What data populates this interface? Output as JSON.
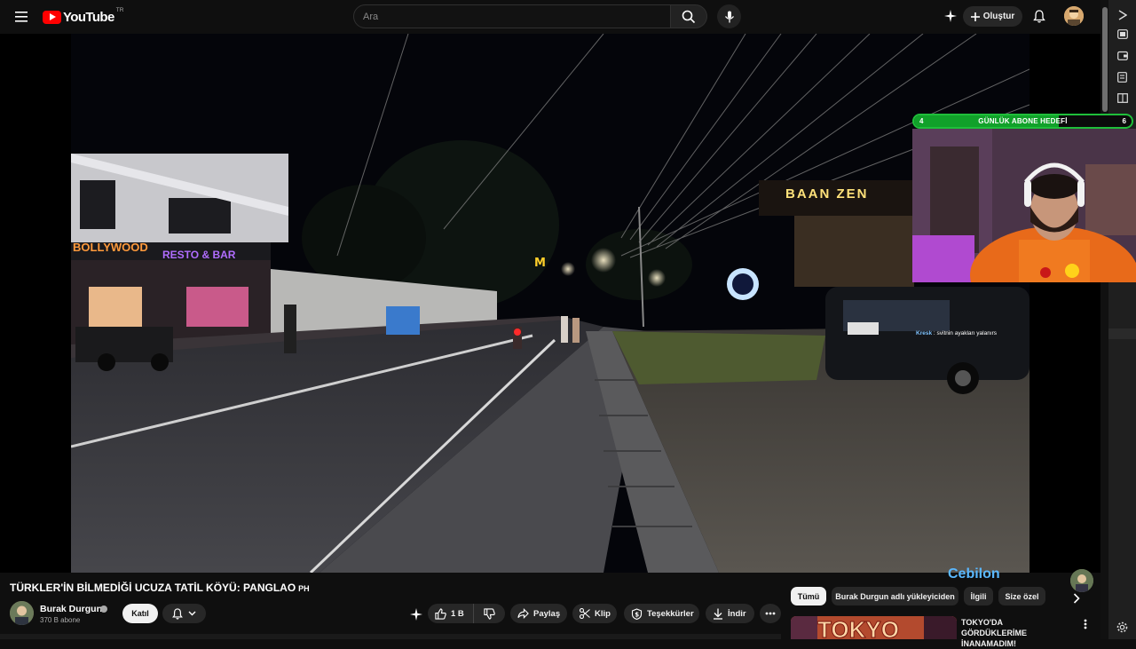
{
  "topbar": {
    "logo_text": "YouTube",
    "country_code": "TR",
    "search_placeholder": "Ara",
    "create_label": "Oluştur"
  },
  "video": {
    "overlay": {
      "goal_title": "GÜNLÜK ABONE HEDEFİ",
      "goal_current": "4",
      "goal_target": "6",
      "goal_progress": 0.667,
      "chat_user": "Kresk",
      "chat_message": ": svitnin ayakları yalanırs",
      "watermark": "Cebilon"
    },
    "signs": {
      "bollywood": "BOLLYWOOD",
      "resto_bar": "RESTO & BAR",
      "baan": "BAAN ZEN"
    }
  },
  "title": {
    "text": "TÜRKLER'İN BİLMEDİĞİ UCUZA TATİL KÖYÜ: PANGLAO",
    "flag": "PH"
  },
  "channel": {
    "name": "Burak Durgun",
    "subscribers": "370 B abone",
    "join_label": "Katıl"
  },
  "actions": {
    "like_count": "1 B",
    "share_label": "Paylaş",
    "clip_label": "Klip",
    "thanks_label": "Teşekkürler",
    "download_label": "İndir"
  },
  "chips": [
    {
      "label": "Tümü",
      "active": true
    },
    {
      "label": "Burak Durgun adlı yükleyiciden",
      "active": false
    },
    {
      "label": "İlgili",
      "active": false
    },
    {
      "label": "Size özel",
      "active": false
    }
  ],
  "recommendation": {
    "title": "TOKYO'DA GÖRDÜKLERİME İNANAMADIM!",
    "thumb_text": "TOKYO"
  },
  "colors": {
    "brand_red": "#ff0000",
    "goal_green": "#1fbf3a",
    "background": "#0f0f0f"
  }
}
